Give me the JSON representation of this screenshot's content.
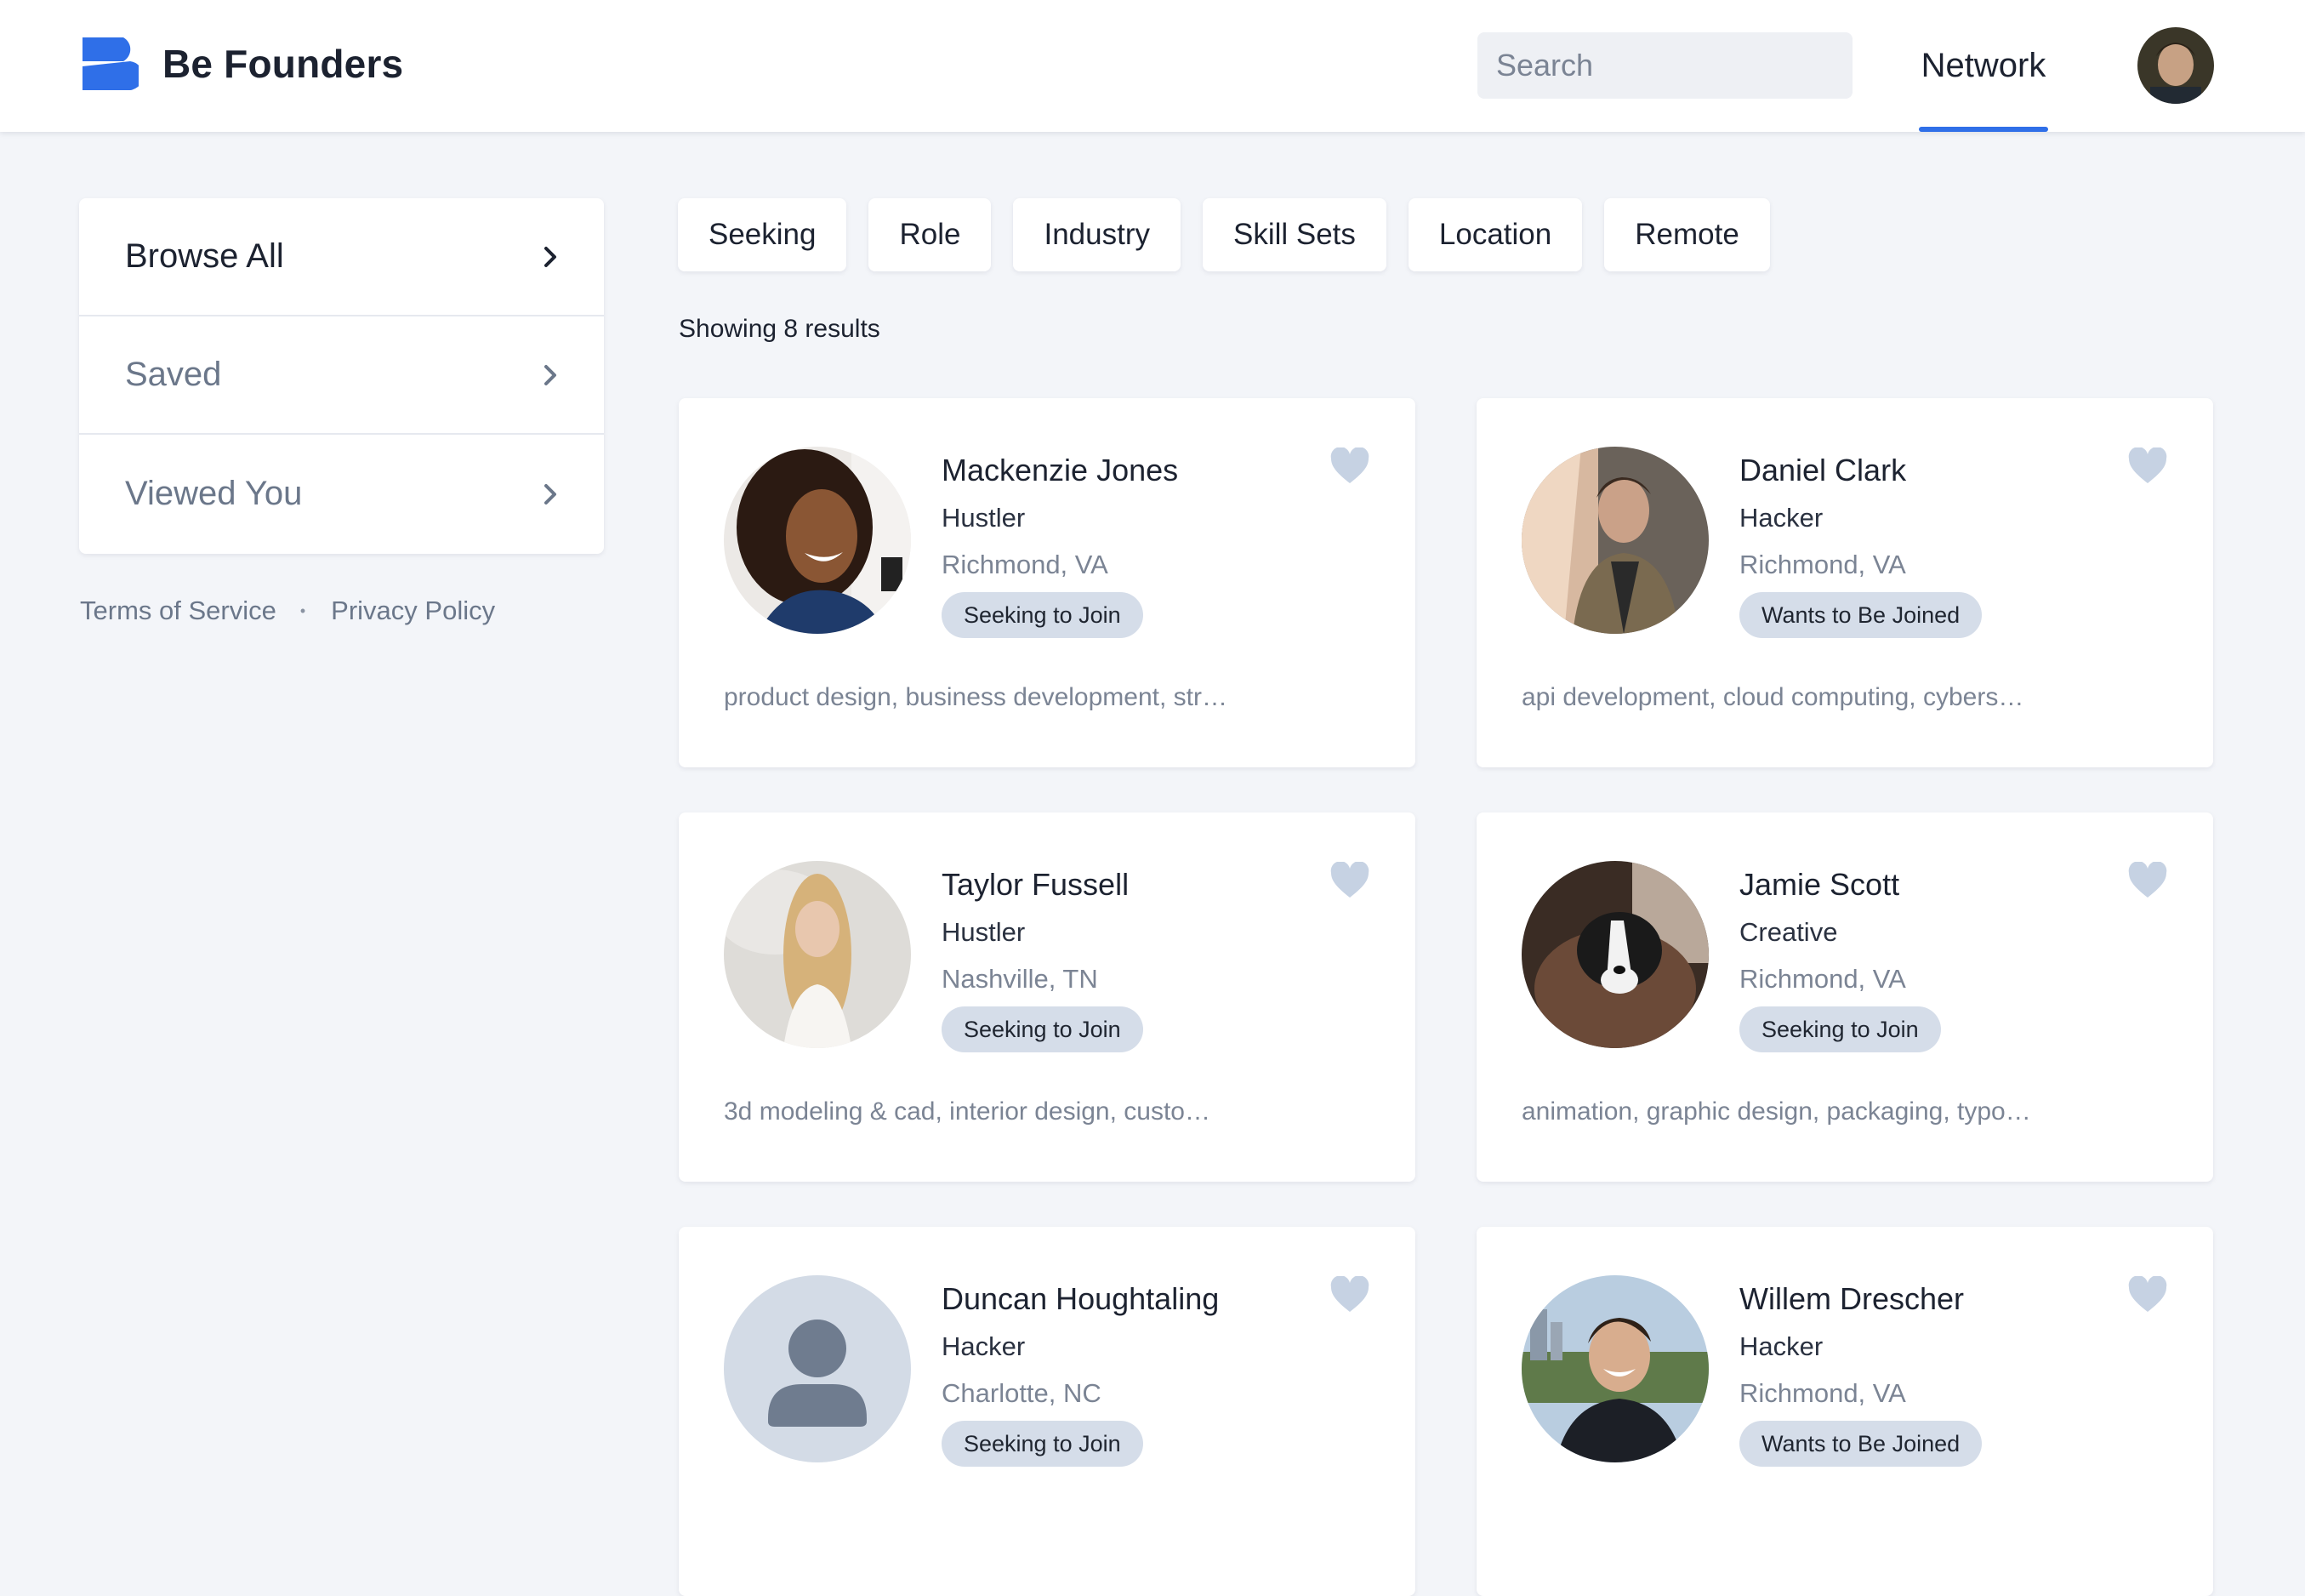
{
  "header": {
    "brand_name": "Be Founders",
    "search_placeholder": "Search",
    "nav_tab": "Network",
    "accent_color": "#2f6fe8"
  },
  "sidebar": {
    "items": [
      {
        "label": "Browse All",
        "active": true
      },
      {
        "label": "Saved",
        "active": false
      },
      {
        "label": "Viewed You",
        "active": false
      }
    ],
    "footer": {
      "terms": "Terms of Service",
      "separator": "•",
      "privacy": "Privacy Policy"
    }
  },
  "filters": [
    "Seeking",
    "Role",
    "Industry",
    "Skill Sets",
    "Location",
    "Remote"
  ],
  "results_text": "Showing 8 results",
  "profiles": [
    {
      "name": "Mackenzie Jones",
      "role": "Hustler",
      "location": "Richmond, VA",
      "status": "Seeking to Join",
      "skills": "product design, business development, str…",
      "photo": "woman-curly-hair-photo"
    },
    {
      "name": "Daniel Clark",
      "role": "Hacker",
      "location": "Richmond, VA",
      "status": "Wants to Be Joined",
      "skills": "api development, cloud computing, cybers…",
      "photo": "man-jacket-photo"
    },
    {
      "name": "Taylor Fussell",
      "role": "Hustler",
      "location": "Nashville, TN",
      "status": "Seeking to Join",
      "skills": "3d modeling & cad, interior design, custo…",
      "photo": "woman-blonde-photo"
    },
    {
      "name": "Jamie Scott",
      "role": "Creative",
      "location": "Richmond, VA",
      "status": "Seeking to Join",
      "skills": "animation, graphic design, packaging, typo…",
      "photo": "puppy-photo"
    },
    {
      "name": "Duncan Houghtaling",
      "role": "Hacker",
      "location": "Charlotte, NC",
      "status": "Seeking to Join",
      "skills": "",
      "photo": "default-avatar-placeholder"
    },
    {
      "name": "Willem Drescher",
      "role": "Hacker",
      "location": "Richmond, VA",
      "status": "Wants to Be Joined",
      "skills": "",
      "photo": "man-smiling-photo"
    }
  ]
}
